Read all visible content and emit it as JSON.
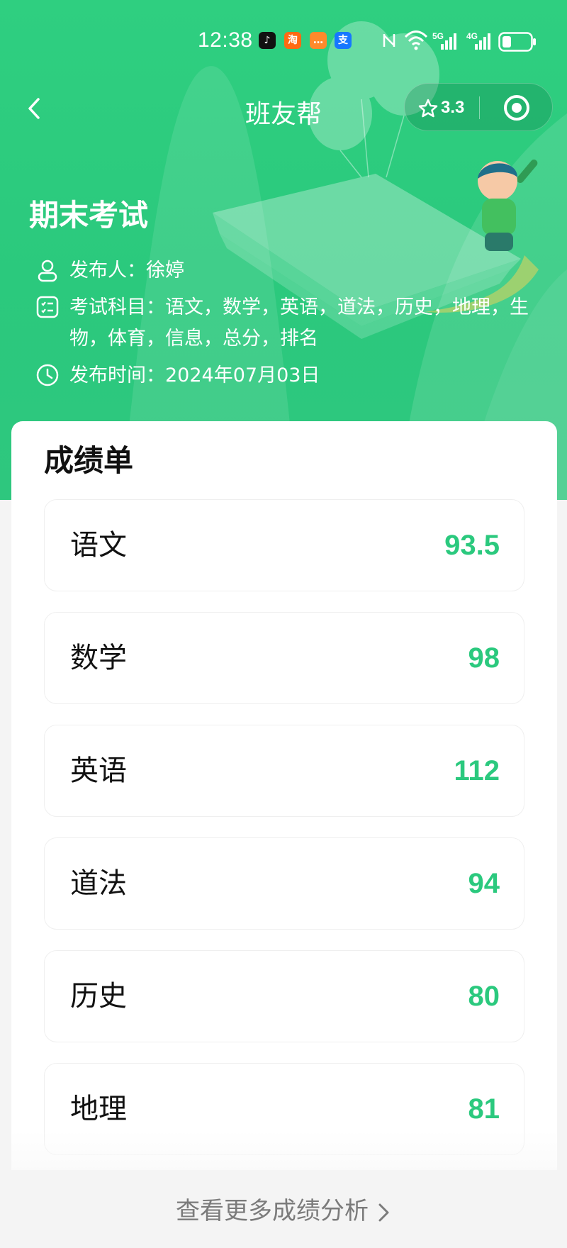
{
  "status_bar": {
    "time": "12:38",
    "apps": [
      {
        "icon": "tiktok-icon",
        "glyph": "♪"
      },
      {
        "icon": "taobao-icon",
        "glyph": "淘"
      },
      {
        "icon": "message-icon",
        "glyph": "…"
      },
      {
        "icon": "alipay-icon",
        "glyph": "支"
      }
    ],
    "network_5g": "5G",
    "network_4g": "4G"
  },
  "nav": {
    "title": "班友帮",
    "rating": "3.3"
  },
  "exam": {
    "title": "期末考试",
    "publisher": "发布人：徐婷",
    "subjects": "考试科目：语文，数学，英语，道法，历史，地理，生物，体育，信息，总分，排名",
    "publish_time": "发布时间：2024年07月03日"
  },
  "report": {
    "title": "成绩单",
    "scores": [
      {
        "subject": "语文",
        "score": "93.5"
      },
      {
        "subject": "数学",
        "score": "98"
      },
      {
        "subject": "英语",
        "score": "112"
      },
      {
        "subject": "道法",
        "score": "94"
      },
      {
        "subject": "历史",
        "score": "80"
      },
      {
        "subject": "地理",
        "score": "81"
      }
    ]
  },
  "footer": {
    "more_link": "查看更多成绩分析"
  },
  "colors": {
    "brand_green": "#2bc97d",
    "score_green": "#2bc97e",
    "card_bg": "#ffffff",
    "page_bg": "#f4f4f4"
  }
}
